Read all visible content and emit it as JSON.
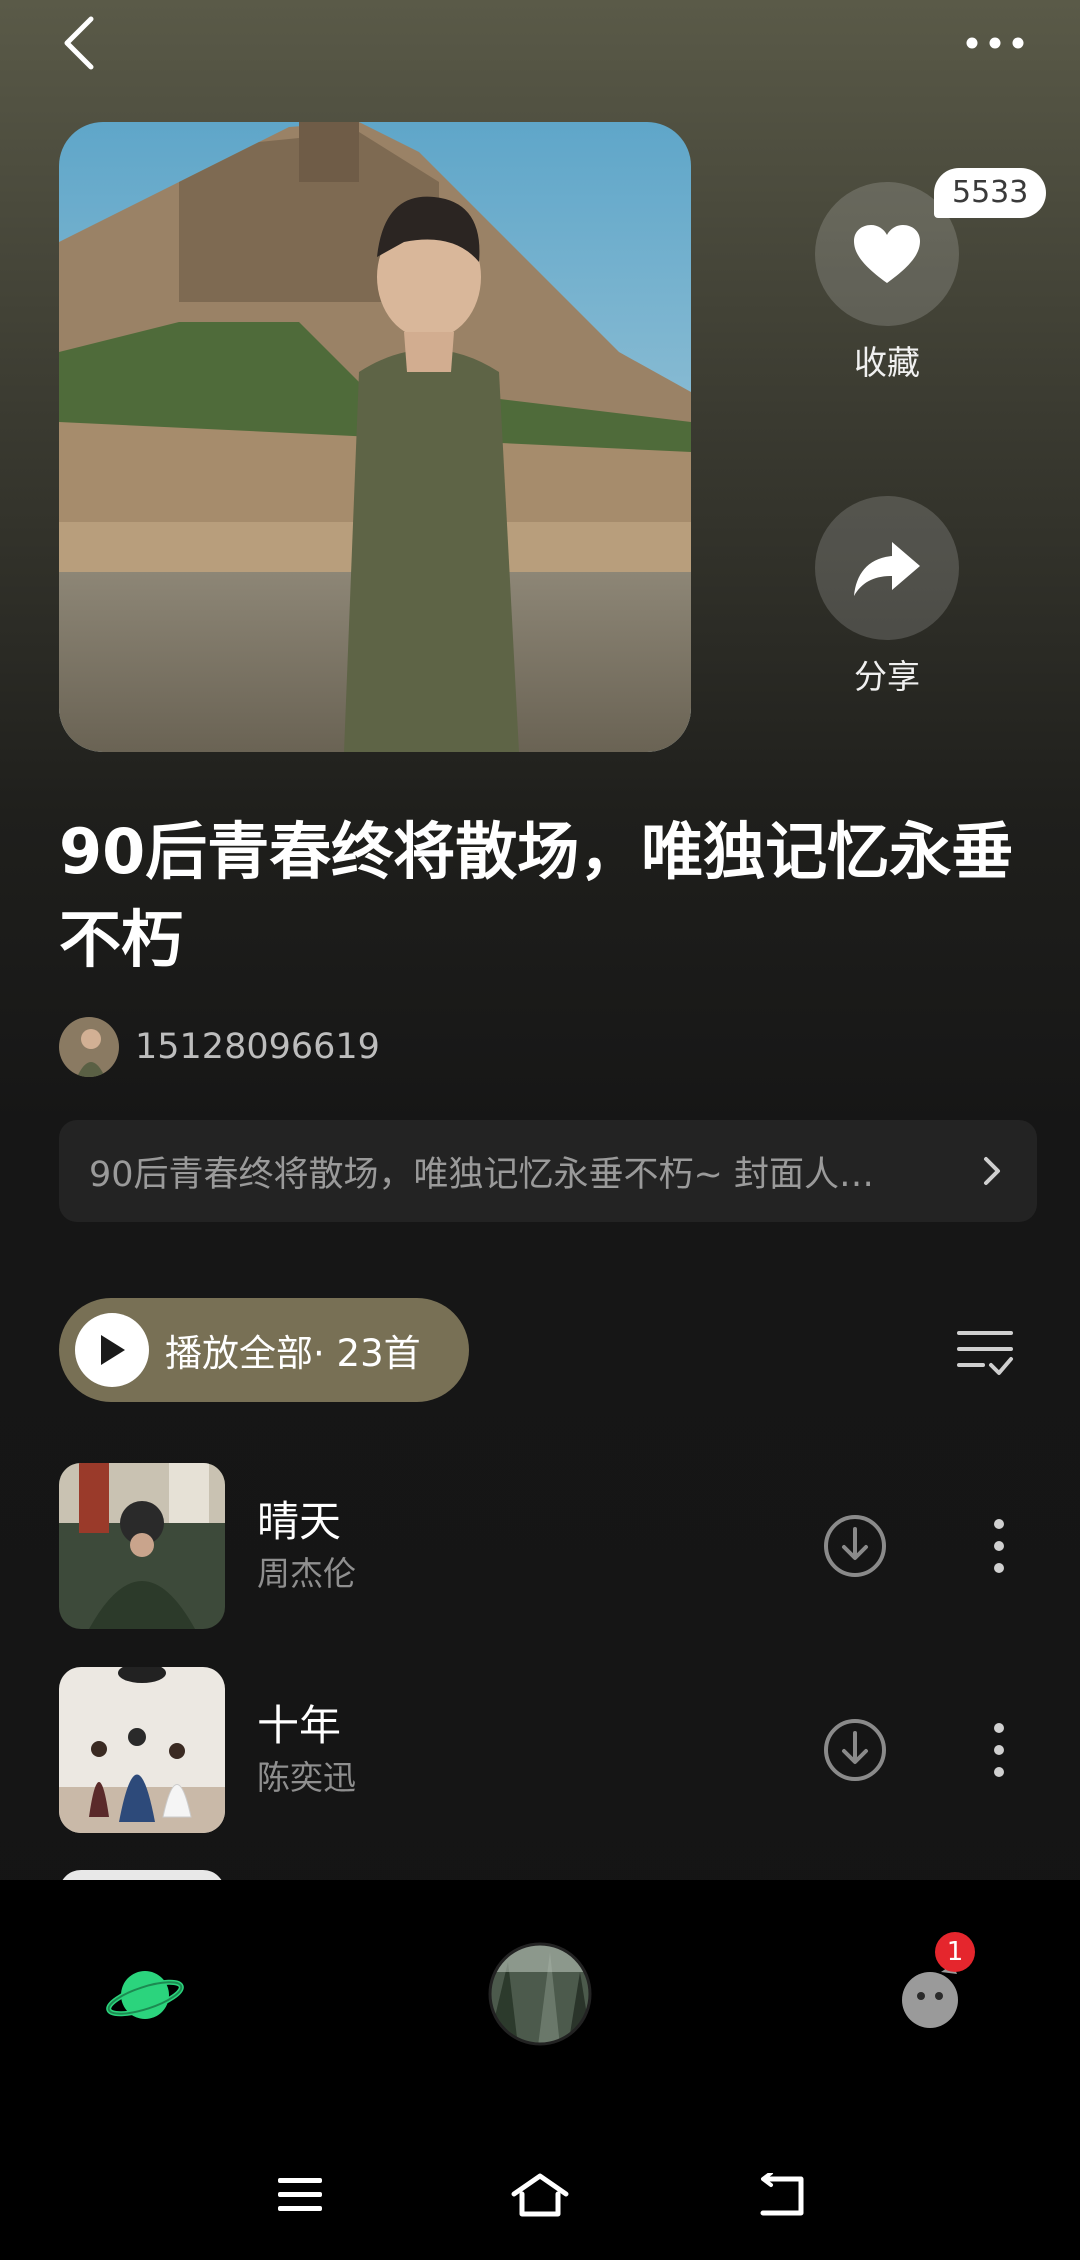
{
  "header": {
    "back_icon": "chevron-left-icon",
    "more_icon": "more-horizontal-icon"
  },
  "playlist": {
    "title": "90后青春终将散场，唯独记忆永垂不朽",
    "creator_name": "15128096619",
    "description": "90后青春终将散场，唯独记忆永垂不朽~ 封面人…",
    "favorite_count": "5533",
    "favorite_label": "收藏",
    "share_label": "分享"
  },
  "actions": {
    "play_all_label": "播放全部",
    "play_all_count": "· 23首"
  },
  "songs": [
    {
      "title": "晴天",
      "artist": "周杰伦"
    },
    {
      "title": "十年",
      "artist": "陈奕迅"
    }
  ],
  "bottom_nav": {
    "items": [
      "planet-icon",
      "now-playing-disc",
      "profile-icon"
    ],
    "notification_count": "1"
  },
  "system_nav": [
    "menu-icon",
    "home-icon",
    "back-icon"
  ],
  "colors": {
    "accent_green": "#2bd47d",
    "play_all_bg": "#787055",
    "badge_red": "#e5262d"
  }
}
